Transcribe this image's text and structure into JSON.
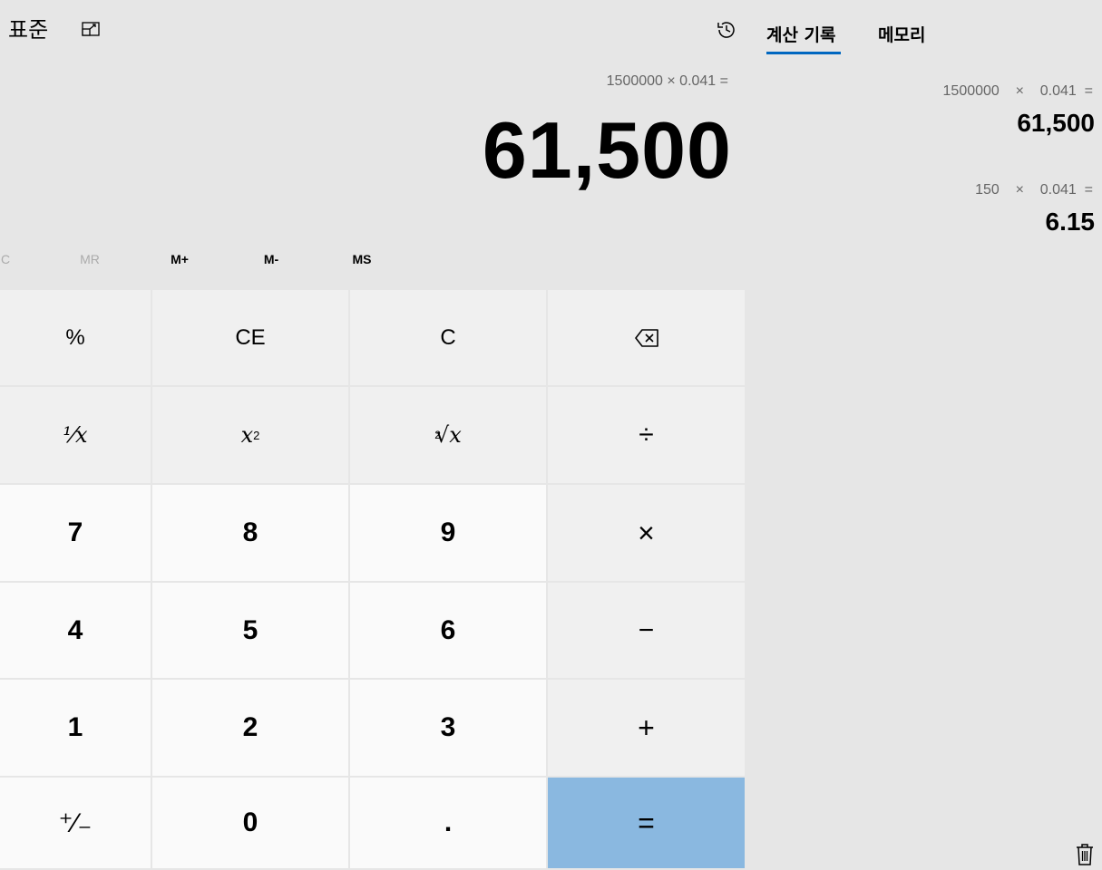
{
  "header": {
    "mode_title": "표준",
    "keep_on_top_icon": "keep-on-top-icon"
  },
  "display": {
    "expression": "1500000 × 0.041 =",
    "result": "61,500"
  },
  "memory_bar": {
    "mc": "C",
    "mr": "MR",
    "mplus": "M+",
    "mminus": "M-",
    "ms": "MS"
  },
  "keys": {
    "percent": "%",
    "ce": "CE",
    "c": "C",
    "backspace_icon": "backspace-icon",
    "reciprocal": "¹⁄x",
    "square_base": "x",
    "square_exp": "2",
    "sqrt_index": "2",
    "sqrt_radical": "√x",
    "divide": "÷",
    "seven": "7",
    "eight": "8",
    "nine": "9",
    "multiply": "×",
    "four": "4",
    "five": "5",
    "six": "6",
    "minus": "−",
    "one": "1",
    "two": "2",
    "three": "3",
    "plus": "+",
    "negate": "⁺⁄₋",
    "zero": "0",
    "decimal": ".",
    "equals": "="
  },
  "side_panel": {
    "history_icon": "history-icon",
    "tabs": [
      {
        "label": "계산 기록",
        "active": true
      },
      {
        "label": "메모리",
        "active": false
      }
    ],
    "history": [
      {
        "expr": "1500000    ×    0.041  =",
        "result": "61,500"
      },
      {
        "expr": "150    ×    0.041  =",
        "result": "6.15"
      }
    ],
    "clear_icon": "trash-icon"
  },
  "colors": {
    "background": "#e6e6e6",
    "function_key": "#f0f0f0",
    "number_key": "#fafafa",
    "equals_key": "#8ab8e0",
    "accent": "#0067c0"
  }
}
